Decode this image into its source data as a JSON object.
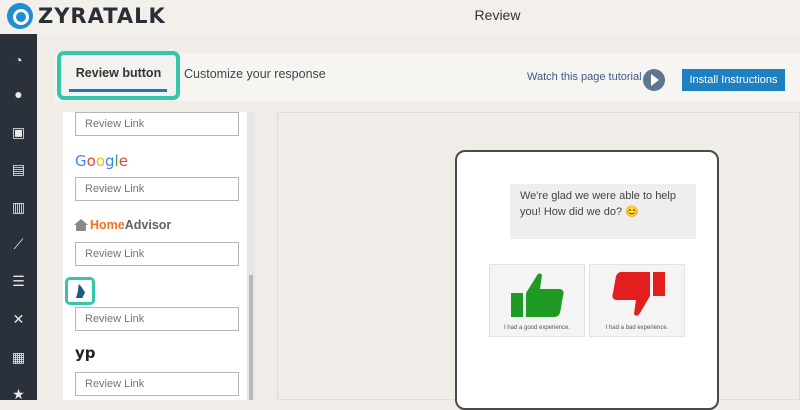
{
  "app": {
    "name": "ZYRATALK",
    "page_title": "Review"
  },
  "sidebar": {
    "icons": [
      "gauge-icon",
      "chat-icon",
      "calendar-icon",
      "document-icon",
      "contacts-icon",
      "chart-line-icon",
      "list-icon",
      "expand-icon",
      "reports-icon",
      "star-icon"
    ]
  },
  "tabs": {
    "review_button": "Review button",
    "customize": "Customize your response"
  },
  "header": {
    "tutorial_link": "Watch this page tutorial",
    "install_button": "Install Instructions"
  },
  "review_sites": [
    {
      "brand": "",
      "placeholder": "Review Link"
    },
    {
      "brand": "Google",
      "placeholder": "Review Link"
    },
    {
      "brand": "HomeAdvisor",
      "brand_parts": [
        "Home",
        "Advisor"
      ],
      "placeholder": "Review Link"
    },
    {
      "brand": "bbb-logo",
      "placeholder": "Review Link"
    },
    {
      "brand": "yp",
      "placeholder": "Review Link"
    }
  ],
  "preview": {
    "message": "We're glad we were able to help you! How did we do? 😊",
    "good_label": "I had a good experience.",
    "bad_label": "I had a bad experience."
  },
  "colors": {
    "accent": "#36c5a8",
    "primary": "#1e80c1",
    "sidebar": "#2b313a",
    "thumb_up": "#1f9b25",
    "thumb_down": "#e31e1e"
  }
}
